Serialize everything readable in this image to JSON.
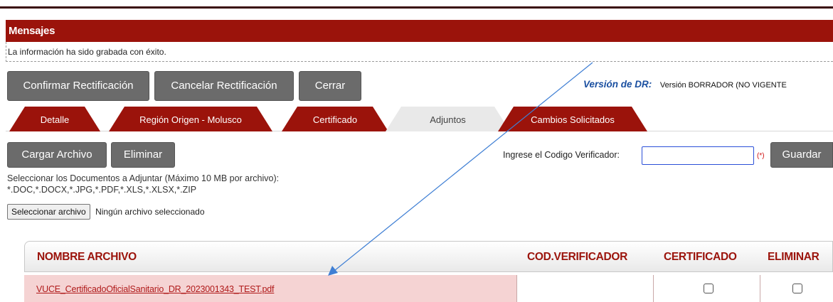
{
  "messages": {
    "title": "Mensajes",
    "text": "La información ha sido grabada con éxito."
  },
  "toolbar": {
    "confirm_label": "Confirmar Rectificación",
    "cancel_label": "Cancelar Rectificación",
    "close_label": "Cerrar"
  },
  "version": {
    "label": "Versión de DR:",
    "value": "Versión BORRADOR (NO VIGENTE"
  },
  "tabs": [
    {
      "label": "Detalle",
      "active": false
    },
    {
      "label": "Región Origen - Molusco",
      "active": false
    },
    {
      "label": "Certificado",
      "active": false
    },
    {
      "label": "Adjuntos",
      "active": true
    },
    {
      "label": "Cambios Solicitados",
      "active": false
    }
  ],
  "attachments": {
    "upload_label": "Cargar Archivo",
    "delete_label": "Eliminar",
    "verifier_label": "Ingrese el Codigo Verificador:",
    "verifier_value": "",
    "required_mark": "(*)",
    "save_label": "Guardar",
    "instructions_line1": "Seleccionar los Documentos a Adjuntar (Máximo 10 MB por archivo):",
    "instructions_line2": "*.DOC,*.DOCX,*.JPG,*.PDF,*.XLS,*.XLSX,*.ZIP",
    "file_button_label": "Seleccionar archivo",
    "file_status": "Ningún archivo seleccionado"
  },
  "grid": {
    "columns": [
      "NOMBRE ARCHIVO",
      "COD.VERIFICADOR",
      "CERTIFICADO",
      "ELIMINAR"
    ],
    "rows": [
      {
        "file_name": "VUCE_CertificadoOficialSanitario_DR_2023001343_TEST.pdf",
        "verifier": "",
        "certificado": false,
        "eliminar": false
      }
    ]
  },
  "colors": {
    "brand_red": "#9b130b",
    "button_gray": "#6b6b6b",
    "row_highlight": "#f5d3d3",
    "annotation_arrow": "#3f7fd4"
  },
  "annotation": {
    "arrow_icon": "annotation-arrow-icon"
  }
}
